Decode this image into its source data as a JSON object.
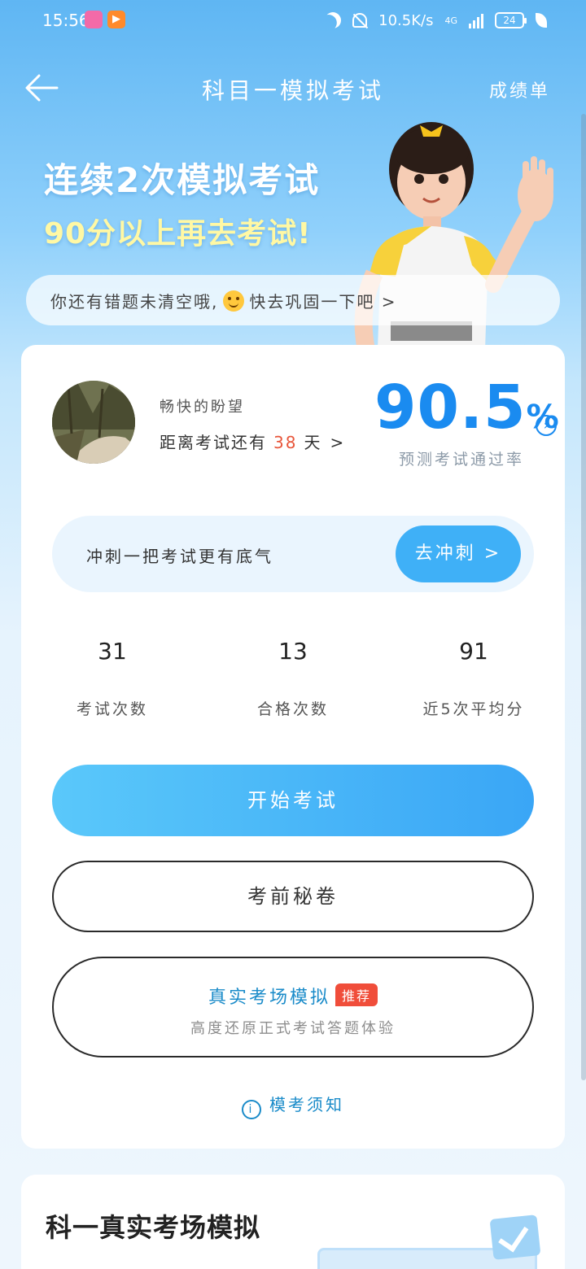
{
  "status_bar": {
    "time": "15:56",
    "network_speed": "10.5K/s",
    "network_type": "4G",
    "battery": "24"
  },
  "header": {
    "title": "科目一模拟考试",
    "right_link": "成绩单"
  },
  "banner": {
    "line1": "连续2次模拟考试",
    "line2": "90分以上再去考试!"
  },
  "tip": {
    "text_before": "你还有错题未清空哦,",
    "text_after": "快去巩固一下吧 >"
  },
  "profile": {
    "user_name": "畅快的盼望",
    "countdown_prefix": "距离考试还有",
    "countdown_days": "38",
    "countdown_suffix": "天"
  },
  "pass_rate": {
    "value": "90.5",
    "unit": "%",
    "label": "预测考试通过率"
  },
  "sprint": {
    "text": "冲刺一把考试更有底气",
    "button": "去冲刺 >"
  },
  "stats": [
    {
      "value": "31",
      "label": "考试次数"
    },
    {
      "value": "13",
      "label": "合格次数"
    },
    {
      "value": "91",
      "label": "近5次平均分"
    }
  ],
  "buttons": {
    "start": "开始考试",
    "secret": "考前秘卷",
    "real_title": "真实考场模拟",
    "real_badge": "推荐",
    "real_sub": "高度还原正式考试答题体验"
  },
  "notice": "模考须知",
  "second_card": {
    "title": "科一真实考场模拟"
  },
  "colors": {
    "accent_blue": "#1a8bf0",
    "button_blue": "#3fb0f7",
    "badge_red": "#f04d3a",
    "days_red": "#e8563b",
    "banner_yellow": "#fff8a4"
  }
}
